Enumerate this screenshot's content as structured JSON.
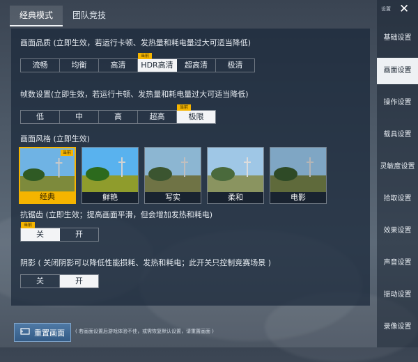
{
  "tabs": [
    "经典模式",
    "团队竞技"
  ],
  "current_tag": "当前",
  "quality": {
    "label": "画面品质 (立即生效，若运行卡顿、发热量和耗电量过大可适当降低)",
    "options": [
      "流畅",
      "均衡",
      "高清",
      "HDR高清",
      "超高清",
      "极清"
    ],
    "selected": "HDR高清"
  },
  "framerate": {
    "label": "帧数设置(立即生效，若运行卡顿、发热量和耗电量过大可适当降低)",
    "options": [
      "低",
      "中",
      "高",
      "超高",
      "极限"
    ],
    "selected": "极限"
  },
  "style": {
    "label": "画面风格 (立即生效)",
    "options": [
      "经典",
      "鲜艳",
      "写实",
      "柔和",
      "电影"
    ],
    "selected": "经典"
  },
  "antialias": {
    "label": "抗锯齿 (立即生效；提高画面平滑，但会增加发热和耗电)",
    "options": [
      "关",
      "开"
    ],
    "selected": "关"
  },
  "shadow": {
    "label": "阴影 ( 关闭阴影可以降低性能损耗、发热和耗电；此开关只控制竞赛场景 )",
    "options": [
      "关",
      "开"
    ],
    "selected": "开"
  },
  "reset": {
    "label": "重置画面",
    "note": "( 若画面设置后游戏体验不佳，或需恢复默认设置，请重置画面 )"
  },
  "sidebar": {
    "title": "设置",
    "items": [
      "基础设置",
      "画面设置",
      "操作设置",
      "载具设置",
      "灵敏度设置",
      "拾取设置",
      "效果设置",
      "声音设置",
      "振动设置",
      "录像设置"
    ],
    "active": "画面设置"
  },
  "icons": {
    "close": "close-icon",
    "reset": "reset-icon"
  },
  "colors": {
    "accent": "#f5b400",
    "panel": "#1a283a",
    "selected": "#f3f4f6"
  }
}
